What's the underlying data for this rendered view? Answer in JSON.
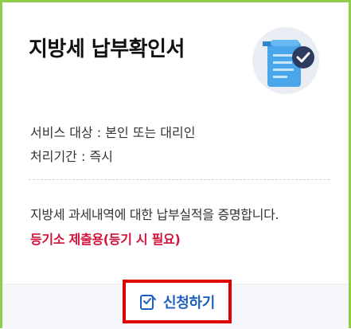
{
  "card": {
    "title": "지방세 납부확인서",
    "illustration_icon": "document-check-icon",
    "service_target": "서비스 대상 : 본인 또는 대리인",
    "processing_time": "처리기간 : 즉시",
    "description": "지방세 과세내역에 대한 납부실적을 증명합니다.",
    "note": "등기소 제출용(등기 시 필요)"
  },
  "action": {
    "apply_label": "신청하기",
    "apply_icon": "edit-form-icon"
  },
  "colors": {
    "border": "#8fce49",
    "note": "#d3123a",
    "apply_text": "#1f5fbf",
    "highlight": "#e00000",
    "footer_bg": "#f5f7fa"
  }
}
